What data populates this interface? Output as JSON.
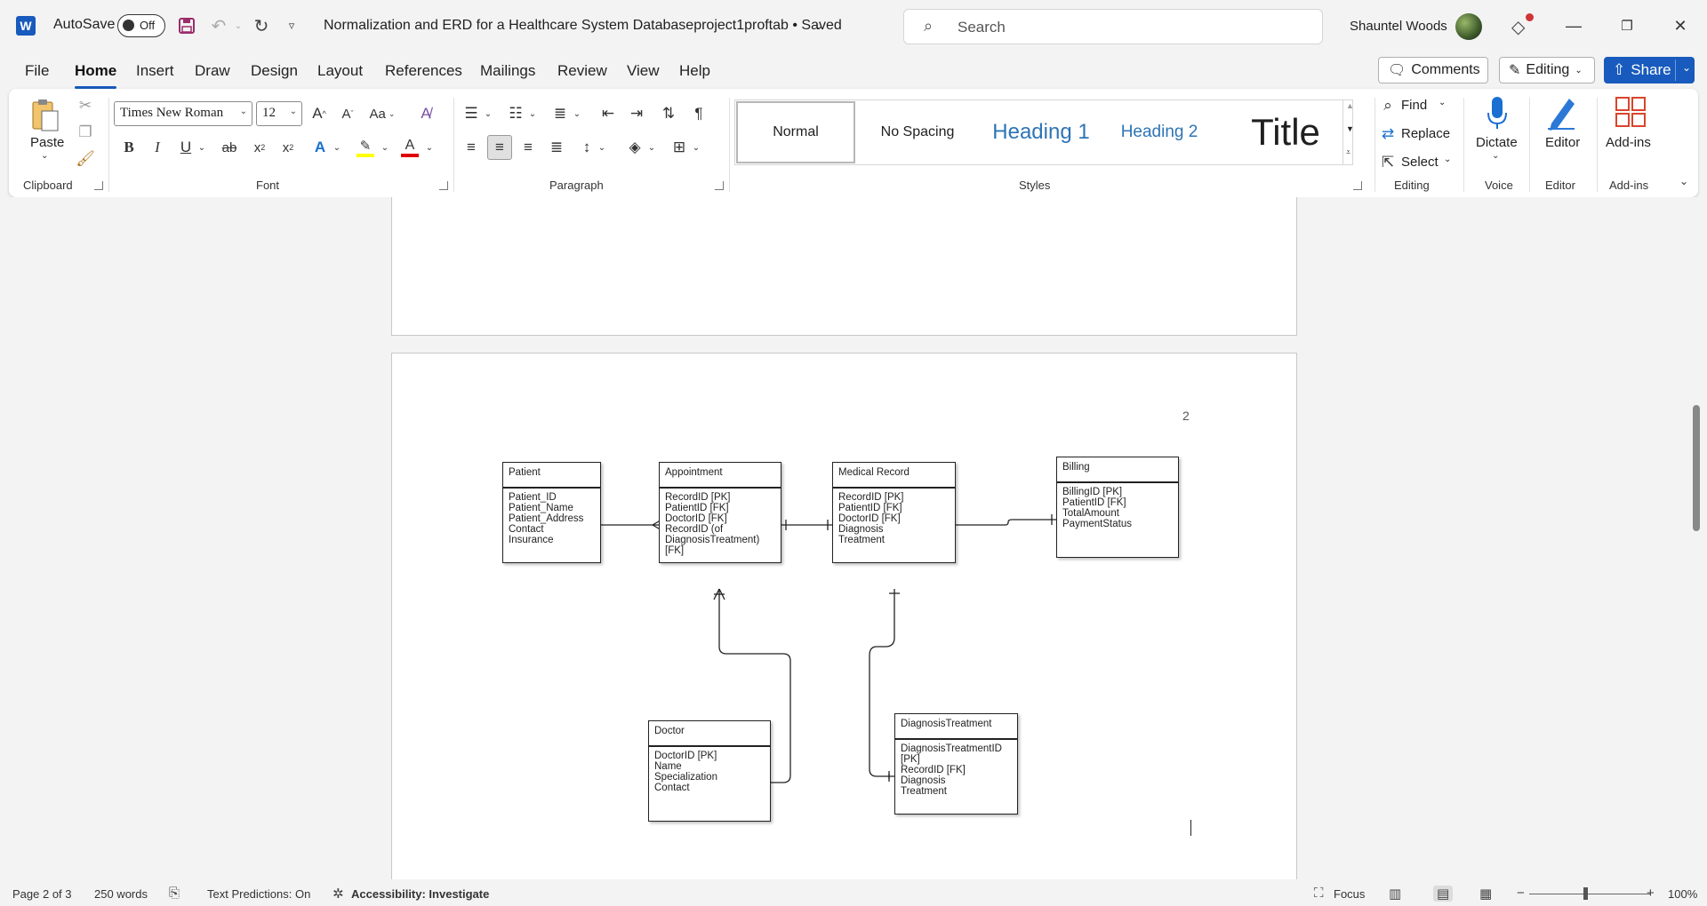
{
  "titlebar": {
    "app_logo": "W",
    "autosave_label": "AutoSave",
    "autosave_state": "Off",
    "document_title": "Normalization and ERD for a Healthcare System Databaseproject1proftab • Saved",
    "search_placeholder": "Search",
    "user_name": "Shauntel Woods"
  },
  "menu": {
    "tabs": [
      "File",
      "Home",
      "Insert",
      "Draw",
      "Design",
      "Layout",
      "References",
      "Mailings",
      "Review",
      "View",
      "Help"
    ],
    "active_tab": "Home",
    "comments_label": "Comments",
    "editing_label": "Editing",
    "share_label": "Share"
  },
  "ribbon": {
    "clipboard": {
      "paste_label": "Paste",
      "group_label": "Clipboard"
    },
    "font": {
      "font_name": "Times New Roman",
      "font_size": "12",
      "group_label": "Font",
      "case_label": "Aa"
    },
    "paragraph": {
      "group_label": "Paragraph"
    },
    "styles": {
      "group_label": "Styles",
      "items": [
        "Normal",
        "No Spacing",
        "Heading 1",
        "Heading 2",
        "Title"
      ],
      "selected": "Normal",
      "heading_color": "#2e74b5"
    },
    "editing": {
      "find_label": "Find",
      "replace_label": "Replace",
      "select_label": "Select",
      "group_label": "Editing"
    },
    "voice": {
      "dictate_label": "Dictate",
      "group_label": "Voice"
    },
    "editor": {
      "editor_label": "Editor",
      "group_label": "Editor"
    },
    "addins": {
      "addins_label": "Add-ins",
      "group_label": "Add-ins"
    }
  },
  "document": {
    "page_number": "2",
    "entities": [
      {
        "id": "patient",
        "title": "Patient",
        "fields": [
          "Patient_ID",
          "Patient_Name",
          "Patient_Address",
          "Contact",
          "Insurance"
        ]
      },
      {
        "id": "appointment",
        "title": "Appointment",
        "fields": [
          "RecordID [PK]",
          "PatientID [FK]",
          "DoctorID [FK]",
          "RecordID (of",
          "DiagnosisTreatment)",
          "[FK]"
        ]
      },
      {
        "id": "medical-record",
        "title": "Medical Record",
        "fields": [
          "RecordID [PK]",
          "PatientID [FK]",
          "DoctorID [FK]",
          "Diagnosis",
          "Treatment"
        ]
      },
      {
        "id": "billing",
        "title": "Billing",
        "fields": [
          "BillingID [PK]",
          "PatientID [FK]",
          "TotalAmount",
          "PaymentStatus"
        ]
      },
      {
        "id": "doctor",
        "title": "Doctor",
        "fields": [
          "DoctorID [PK]",
          "Name",
          "Specialization",
          "Contact"
        ]
      },
      {
        "id": "diagnosis-treatment",
        "title": "DiagnosisTreatment",
        "fields": [
          "DiagnosisTreatmentID",
          "[PK]",
          "RecordID [FK]",
          "Diagnosis",
          "Treatment"
        ]
      }
    ]
  },
  "status": {
    "page_info": "Page 2 of 3",
    "word_count": "250 words",
    "text_predictions": "Text Predictions: On",
    "accessibility": "Accessibility: Investigate",
    "focus_label": "Focus",
    "zoom_level": "100%"
  },
  "colors": {
    "brand_blue": "#185abd",
    "highlight_yellow": "#ffff00",
    "font_color_red": "#e00000",
    "notification_red": "#d13438"
  }
}
